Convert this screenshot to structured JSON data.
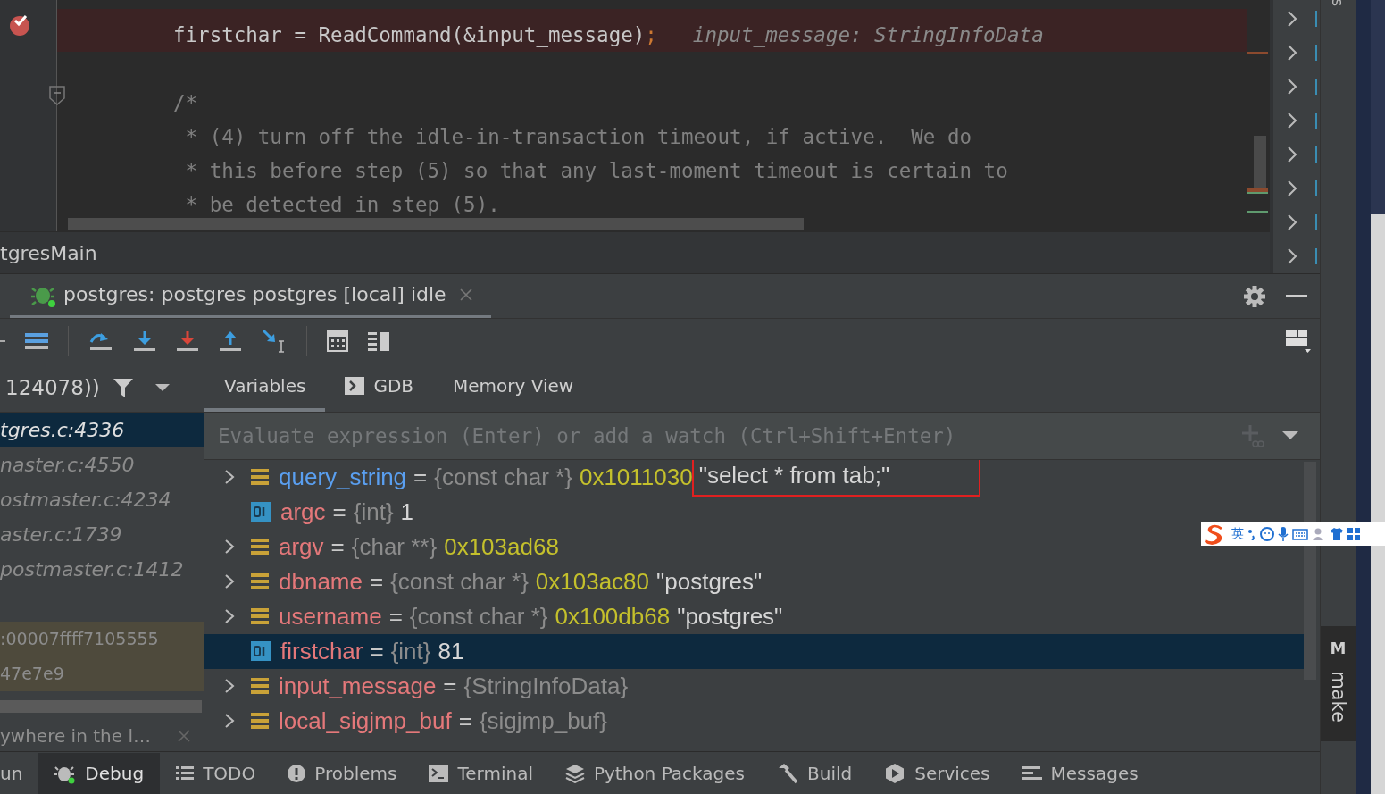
{
  "editor": {
    "lines": [
      {
        "kind": "code",
        "text": "firstchar = ReadCommand(&input_message)",
        "punct": ";",
        "hint": "input_message: StringInfoData",
        "breakpoint": true
      },
      {
        "kind": "blank",
        "breakpoint": false
      },
      {
        "kind": "comment",
        "text": "/*",
        "breakpoint": false,
        "fold": true
      },
      {
        "kind": "comment",
        "text": " * (4) turn off the idle-in-transaction timeout, if active.  We do",
        "breakpoint": false,
        "fold": false
      },
      {
        "kind": "comment",
        "text": " * this before step (5) so that any last-moment timeout is certain to",
        "breakpoint": false,
        "fold": false
      },
      {
        "kind": "comment",
        "text": " * be detected in step (5).",
        "breakpoint": false,
        "fold": false
      }
    ]
  },
  "breadcrumb": "tgresMain",
  "debug_tab": {
    "label": "postgres: postgres postgres [local] idle"
  },
  "frames_header": {
    "thread": "124078))"
  },
  "frames": [
    {
      "text": "tgres.c:4336",
      "kind": "source",
      "selected": true
    },
    {
      "text": "naster.c:4550",
      "kind": "source",
      "selected": false
    },
    {
      "text": "ostmaster.c:4234",
      "kind": "source",
      "selected": false
    },
    {
      "text": "aster.c:1739",
      "kind": "source",
      "selected": false
    },
    {
      "text": "postmaster.c:1412",
      "kind": "source",
      "selected": false
    },
    {
      "text": ":00007ffff7105555",
      "kind": "library",
      "selected": false
    },
    {
      "text": "47e7e9",
      "kind": "library",
      "selected": false
    }
  ],
  "frames_footer": "ywhere in the l…",
  "var_tabs": [
    {
      "label": "Variables",
      "kind": "plain",
      "selected": true
    },
    {
      "label": "GDB",
      "kind": "console",
      "selected": false
    },
    {
      "label": "Memory View",
      "kind": "plain",
      "selected": false
    }
  ],
  "evaluate": {
    "placeholder": "Evaluate expression (Enter) or add a watch (Ctrl+Shift+Enter)"
  },
  "variables": [
    {
      "name": "query_string",
      "eq": "=",
      "type": "{const char *}",
      "address": "0x1011030",
      "value": "\"select * from tab;\"",
      "kind": "pointer",
      "color": "#5a9ff0",
      "selected": false,
      "marked": true
    },
    {
      "name": "argc",
      "eq": "=",
      "type": "{int}",
      "value": "1",
      "kind": "scalar",
      "color": "#e4787a",
      "selected": false,
      "marked": false
    },
    {
      "name": "argv",
      "eq": "=",
      "type": "{char **}",
      "address": "0x103ad68",
      "kind": "pointer",
      "color": "#e4787a",
      "selected": false
    },
    {
      "name": "dbname",
      "eq": "=",
      "type": "{const char *}",
      "address": "0x103ac80",
      "value": "\"postgres\"",
      "kind": "pointer",
      "color": "#e4787a",
      "selected": false,
      "marked": false
    },
    {
      "name": "username",
      "eq": "=",
      "type": "{const char *}",
      "address": "0x100db68",
      "value": "\"postgres\"",
      "kind": "pointer",
      "color": "#e4787a",
      "selected": false,
      "marked": false
    },
    {
      "name": "firstchar",
      "eq": "=",
      "type": "{int}",
      "value": "81",
      "kind": "scalar",
      "color": "#e4787a",
      "selected": true,
      "marked": false
    },
    {
      "name": "input_message",
      "eq": "=",
      "type": "{StringInfoData}",
      "kind": "pointer",
      "color": "#e4787a",
      "selected": false
    },
    {
      "name": "local_sigjmp_buf",
      "eq": "=",
      "type": "{sigjmp_buf}",
      "kind": "pointer",
      "color": "#e4787a",
      "selected": false
    }
  ],
  "bottom_tabs": [
    {
      "label": "un",
      "kind": "run",
      "selected": false
    },
    {
      "label": "Debug",
      "kind": "debug",
      "selected": true
    },
    {
      "label": "TODO",
      "kind": "todo",
      "selected": false
    },
    {
      "label": "Problems",
      "kind": "problems",
      "selected": false
    },
    {
      "label": "Terminal",
      "kind": "terminal",
      "selected": false
    },
    {
      "label": "Python Packages",
      "kind": "packages",
      "selected": false
    },
    {
      "label": "Build",
      "kind": "build",
      "selected": false
    },
    {
      "label": "Services",
      "kind": "services",
      "selected": false
    },
    {
      "label": "Messages",
      "kind": "messages",
      "selected": false
    }
  ],
  "side_strip": {
    "top_label": "s",
    "tool": {
      "letter": "M",
      "label": "make"
    }
  },
  "ime_bar": {
    "label": "英"
  }
}
